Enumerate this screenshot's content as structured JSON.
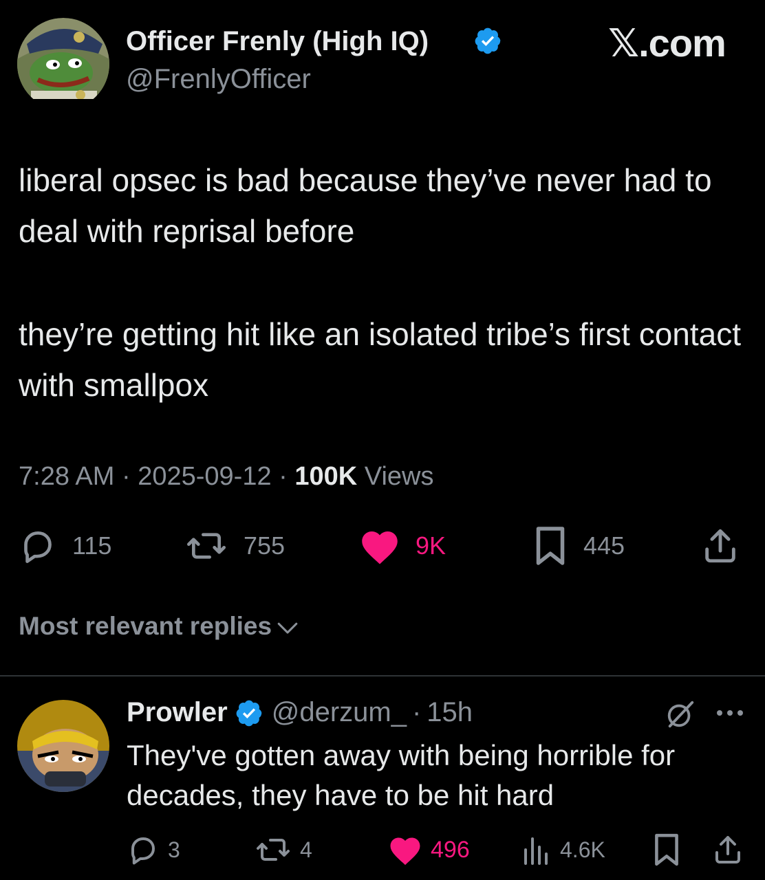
{
  "tweet": {
    "author_name": "Officer Frenly (High IQ)",
    "author_handle": "@FrenlyOfficer",
    "brand": "𝕏.com",
    "text_lines": [
      "liberal opsec is bad because they’ve never had to deal with reprisal before",
      "they’re getting hit like an isolated tribe’s first contact with smallpox"
    ],
    "time": "7:28 AM",
    "date": "2025-09-12",
    "views_count": "100K",
    "views_label": "Views",
    "sep": "·",
    "replies": "115",
    "reposts": "755",
    "likes": "9K",
    "bookmarks": "445"
  },
  "replies_section": {
    "sort_label": "Most relevant replies"
  },
  "reply": {
    "author_name": "Prowler",
    "author_handle": "@derzum_",
    "sep": "·",
    "time": "15h",
    "text": "They've gotten away with being horrible for decades, they have to be hit hard",
    "replies": "3",
    "reposts": "4",
    "likes": "496",
    "views": "4.6K"
  },
  "colors": {
    "background": "#000000",
    "text": "#e7e9ea",
    "secondary": "#8b9199",
    "like": "#f91880",
    "verified": "#1d9bf0"
  },
  "icons": [
    "verified-badge-icon",
    "reply-icon",
    "repost-icon",
    "heart-icon",
    "bookmark-icon",
    "share-icon",
    "chevron-down-icon",
    "grok-icon",
    "more-icon",
    "views-icon"
  ]
}
